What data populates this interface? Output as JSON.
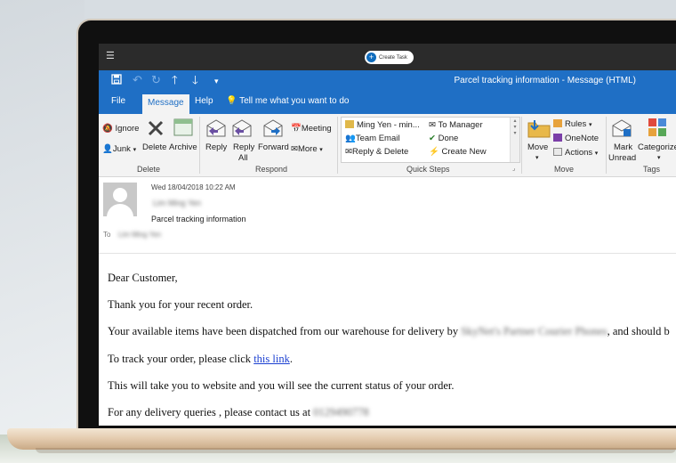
{
  "topbar": {
    "create_task": "Create Task"
  },
  "window": {
    "title": "Parcel tracking information  -  Message (HTML)"
  },
  "tabs": [
    {
      "label": "File"
    },
    {
      "label": "Message"
    },
    {
      "label": "Help"
    }
  ],
  "tell_me": "Tell me what you want to do",
  "ribbon": {
    "delete_group": {
      "label": "Delete",
      "ignore": "Ignore",
      "junk": "Junk",
      "delete": "Delete",
      "archive": "Archive"
    },
    "respond_group": {
      "label": "Respond",
      "reply": "Reply",
      "reply_all_1": "Reply",
      "reply_all_2": "All",
      "forward": "Forward",
      "meeting": "Meeting",
      "more": "More"
    },
    "quick_steps": {
      "label": "Quick Steps",
      "items": [
        "Ming Yen - min...",
        "To Manager",
        "Team Email",
        "Done",
        "Reply & Delete",
        "Create New"
      ]
    },
    "move_group": {
      "label": "Move",
      "move": "Move",
      "rules": "Rules",
      "onenote": "OneNote",
      "actions": "Actions"
    },
    "tags_group": {
      "label": "Tags",
      "mark_unread_1": "Mark",
      "mark_unread_2": "Unread",
      "categorize": "Categorize"
    }
  },
  "message": {
    "date": "Wed 18/04/2018 10:22 AM",
    "from": "Lim Ming Yen",
    "subject": "Parcel tracking information",
    "to_label": "To",
    "to": "Lim Ming Yen"
  },
  "body": {
    "greeting": "Dear Customer,",
    "line1": "Thank you for your recent order.",
    "line2_a": "Your available items have been dispatched from our warehouse for delivery by ",
    "line2_blur": "SkyNet's Partner Courier Phones",
    "line2_b": ", and should b",
    "line3_a": "To track your order, please click ",
    "line3_link": "this link",
    "line3_b": ".",
    "line4": "This will take you to website and you will see the current status of your order.",
    "line5_a": "For any delivery queries , please contact us at ",
    "line5_blur": "0129490778"
  }
}
